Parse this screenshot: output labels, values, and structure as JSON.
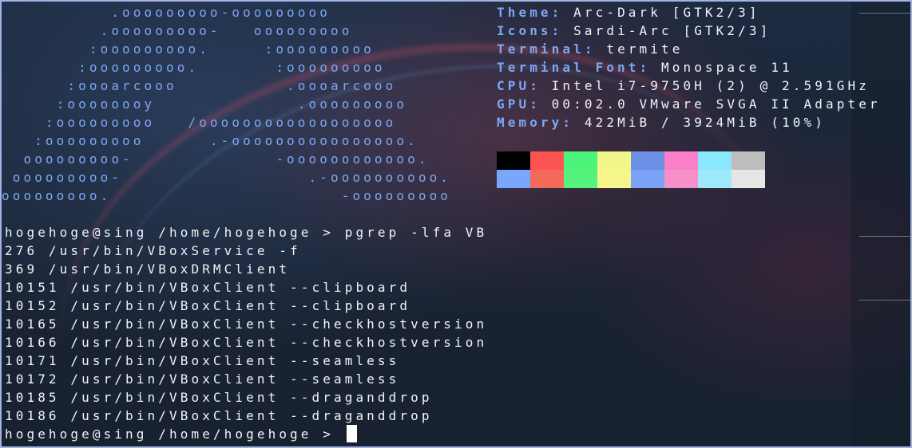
{
  "logo": [
    "          .ooooooooo-ooooooooo",
    "         .ooooooooo-   ooooooooo",
    "        :ooooooooo.     :ooooooooo",
    "       :ooooooooo.       :ooooooooo",
    "      :oooarcooo          .oooarcooo",
    "     :oooooooy             .ooooooooo",
    "    :ooooooooo   /oooooooooooooooooo",
    "   :ooooooooo      .-oooooooooooooooo.",
    "  ooooooooo-             -oooooooooooo.",
    " ooooooooo-                 .-oooooooooo.",
    "ooooooooo.                     -ooooooooo"
  ],
  "info": [
    {
      "key": "Theme",
      "value": "Arc-Dark [GTK2/3]"
    },
    {
      "key": "Icons",
      "value": "Sardi-Arc [GTK2/3]"
    },
    {
      "key": "Terminal",
      "value": "termite"
    },
    {
      "key": "Terminal Font",
      "value": "Monospace 11"
    },
    {
      "key": "CPU",
      "value": "Intel i7-9750H (2) @ 2.591GHz"
    },
    {
      "key": "GPU",
      "value": "00:02.0 VMware SVGA II Adapter"
    },
    {
      "key": "Memory",
      "value": "422MiB / 3924MiB (10%)"
    }
  ],
  "palette": {
    "normal": [
      "#000000",
      "#fc5353",
      "#4cf57a",
      "#f2f58a",
      "#6b8fe2",
      "#fc7fc9",
      "#8ae8fc",
      "#bdbdbd"
    ],
    "bright": [
      "#7aa6fb",
      "#f46a5a",
      "#55f27e",
      "#f6f68a",
      "#7aa2f6",
      "#f78fc8",
      "#9ee9fb",
      "#e6e6e6"
    ]
  },
  "terminal": {
    "prompt": "hogehoge@sing /home/hogehoge > ",
    "command": "pgrep -lfa VB",
    "output": [
      "276 /usr/bin/VBoxService -f",
      "369 /usr/bin/VBoxDRMClient",
      "10151 /usr/bin/VBoxClient --clipboard",
      "10152 /usr/bin/VBoxClient --clipboard",
      "10165 /usr/bin/VBoxClient --checkhostversion",
      "10166 /usr/bin/VBoxClient --checkhostversion",
      "10171 /usr/bin/VBoxClient --seamless",
      "10172 /usr/bin/VBoxClient --seamless",
      "10185 /usr/bin/VBoxClient --draganddrop",
      "10186 /usr/bin/VBoxClient --draganddrop"
    ]
  }
}
